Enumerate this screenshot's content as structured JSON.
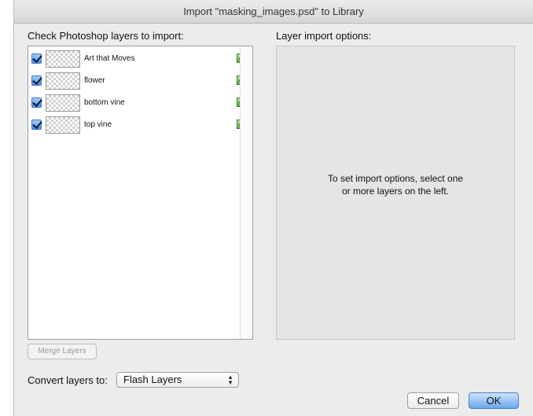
{
  "window": {
    "title": "Import \"masking_images.psd\" to Library"
  },
  "layers_panel": {
    "label": "Check Photoshop layers to import:",
    "items": [
      {
        "name": "Art that Moves",
        "checked": true,
        "icon": "layer-type-icon"
      },
      {
        "name": "flower",
        "checked": true,
        "icon": "layer-type-icon"
      },
      {
        "name": "bottom vine",
        "checked": true,
        "icon": "layer-type-icon"
      },
      {
        "name": "top vine",
        "checked": true,
        "icon": "layer-type-icon"
      }
    ]
  },
  "options_panel": {
    "label": "Layer import options:",
    "hint_line1": "To set import options, select one",
    "hint_line2": "or more layers on the left."
  },
  "merge_button": {
    "label": "Merge Layers",
    "enabled": false
  },
  "convert": {
    "label": "Convert layers to:",
    "selected": "Flash Layers"
  },
  "buttons": {
    "cancel": "Cancel",
    "ok": "OK"
  },
  "colors": {
    "accent": "#4c8ee3",
    "dialog_bg": "#ececec"
  }
}
